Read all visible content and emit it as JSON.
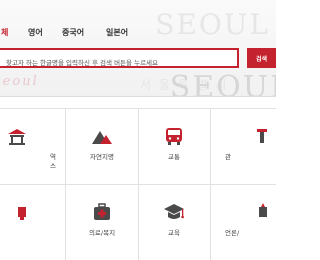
{
  "header": {
    "watermark_top": "SEOUL",
    "watermark_bottom": "SEOUL",
    "tabs": [
      {
        "label": "체"
      },
      {
        "label": "영어"
      },
      {
        "label": "중국어"
      },
      {
        "label": "일본어"
      }
    ],
    "search": {
      "placeholder": "찾고자 하는 한글명을 입력하신 후 검색 버튼을 누르세요",
      "button_label": "검색"
    }
  },
  "categories": [
    {
      "label": "역\n스"
    },
    {
      "label": "자연지명"
    },
    {
      "label": "교통"
    },
    {
      "label": "관"
    },
    {
      "label": ""
    },
    {
      "label": "의료/복지"
    },
    {
      "label": "교육"
    },
    {
      "label": "언론/"
    }
  ],
  "colors": {
    "accent": "#c5222f",
    "icon_dark": "#4a4a4a"
  }
}
